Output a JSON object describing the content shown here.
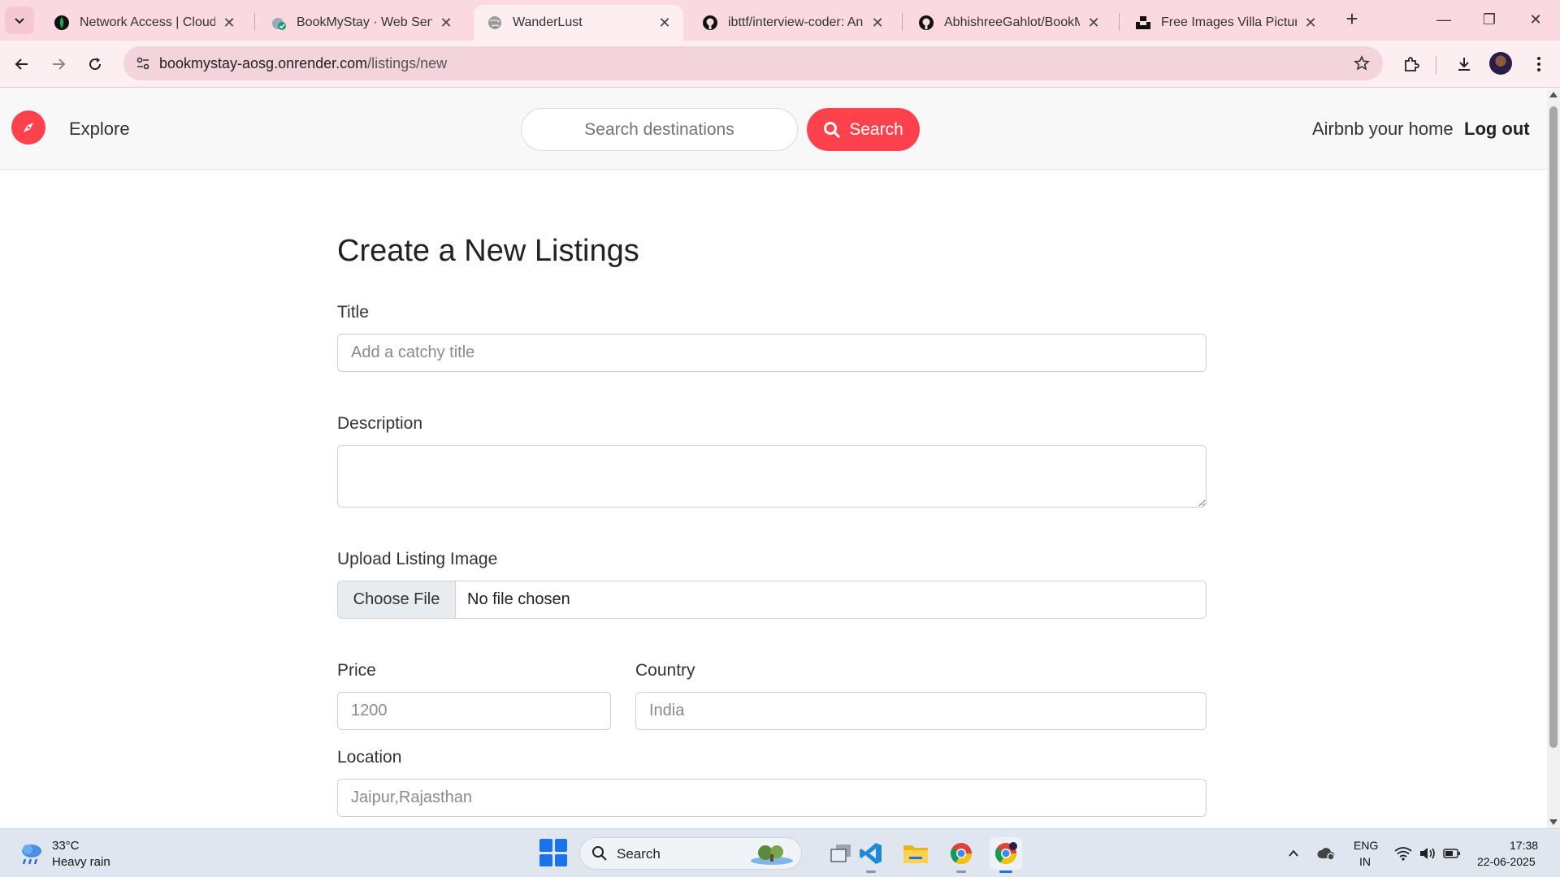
{
  "browser": {
    "tabs": [
      {
        "label": "Network Access | Cloud: M",
        "icon": "mongodb-leaf-icon"
      },
      {
        "label": "BookMyStay · Web Service",
        "icon": "render-icon"
      },
      {
        "label": "WanderLust",
        "icon": "globe-icon"
      },
      {
        "label": "ibttf/interview-coder: An ir",
        "icon": "github-icon"
      },
      {
        "label": "AbhishreeGahlot/BookMyS",
        "icon": "github-icon"
      },
      {
        "label": "Free Images Villa Pictures |",
        "icon": "unsplash-icon"
      }
    ],
    "active_tab_index": 2,
    "url_host": "bookmystay-aosg.onrender.com",
    "url_path": "/listings/new"
  },
  "navbar": {
    "explore_label": "Explore",
    "search_placeholder": "Search destinations",
    "search_button_label": "Search",
    "host_link_label": "Airbnb your home",
    "logout_label": "Log out",
    "accent_color": "#fe424d"
  },
  "form": {
    "heading": "Create a New Listings",
    "title_label": "Title",
    "title_placeholder": "Add a catchy title",
    "description_label": "Description",
    "image_label": "Upload Listing Image",
    "file_button_label": "Choose File",
    "file_status": "No file chosen",
    "price_label": "Price",
    "price_placeholder": "1200",
    "country_label": "Country",
    "country_placeholder": "India",
    "location_label": "Location",
    "location_placeholder": "Jaipur,Rajasthan"
  },
  "taskbar": {
    "weather_temp": "33°C",
    "weather_desc": "Heavy rain",
    "search_label": "Search",
    "lang_line1": "ENG",
    "lang_line2": "IN",
    "time": "17:38",
    "date": "22-06-2025"
  }
}
